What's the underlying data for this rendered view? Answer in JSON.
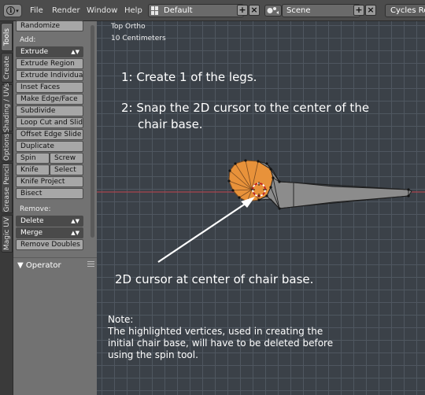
{
  "header": {
    "menus": [
      "File",
      "Render",
      "Window",
      "Help"
    ],
    "screen_layout": "Default",
    "scene": "Scene",
    "render_engine": "Cycles Ren",
    "add_symbol": "+",
    "close_symbol": "×"
  },
  "tabs": [
    "Tools",
    "Create",
    "Shading / UVs",
    "Options",
    "Grease Pencil",
    "Magic UV"
  ],
  "toolshelf": {
    "randomize": "Randomize",
    "add_label": "Add:",
    "extrude_select": "Extrude",
    "buttons": [
      "Extrude Region",
      "Extrude Individual",
      "Inset Faces",
      "Make Edge/Face",
      "Subdivide",
      "Loop Cut and Slide",
      "Offset Edge Slide",
      "Duplicate"
    ],
    "spin": "Spin",
    "screw": "Screw",
    "knife": "Knife",
    "select": "Select",
    "knife_project": "Knife Project",
    "bisect": "Bisect",
    "remove_label": "Remove:",
    "delete_select": "Delete",
    "merge_select": "Merge",
    "remove_doubles": "Remove Doubles",
    "operator_header": "▼ Operator"
  },
  "viewport": {
    "view_name": "Top Ortho",
    "scale": "10 Centimeters",
    "step1": "1: Create 1 of the legs.",
    "step2_line1": "2: Snap the 2D cursor to the center of the",
    "step2_line2": "chair base.",
    "cursor_note": "2D cursor at center of chair base.",
    "note_title": "Note:",
    "note_line1": "The highlighted vertices, used in creating the",
    "note_line2": "initial chair base, will have to be deleted before",
    "note_line3": "using the spin tool."
  },
  "colors": {
    "selected_vertices": "#e8923a",
    "mesh": "#8c8c8c",
    "x_axis": "#a8434b",
    "annotation": "#ffffff"
  }
}
